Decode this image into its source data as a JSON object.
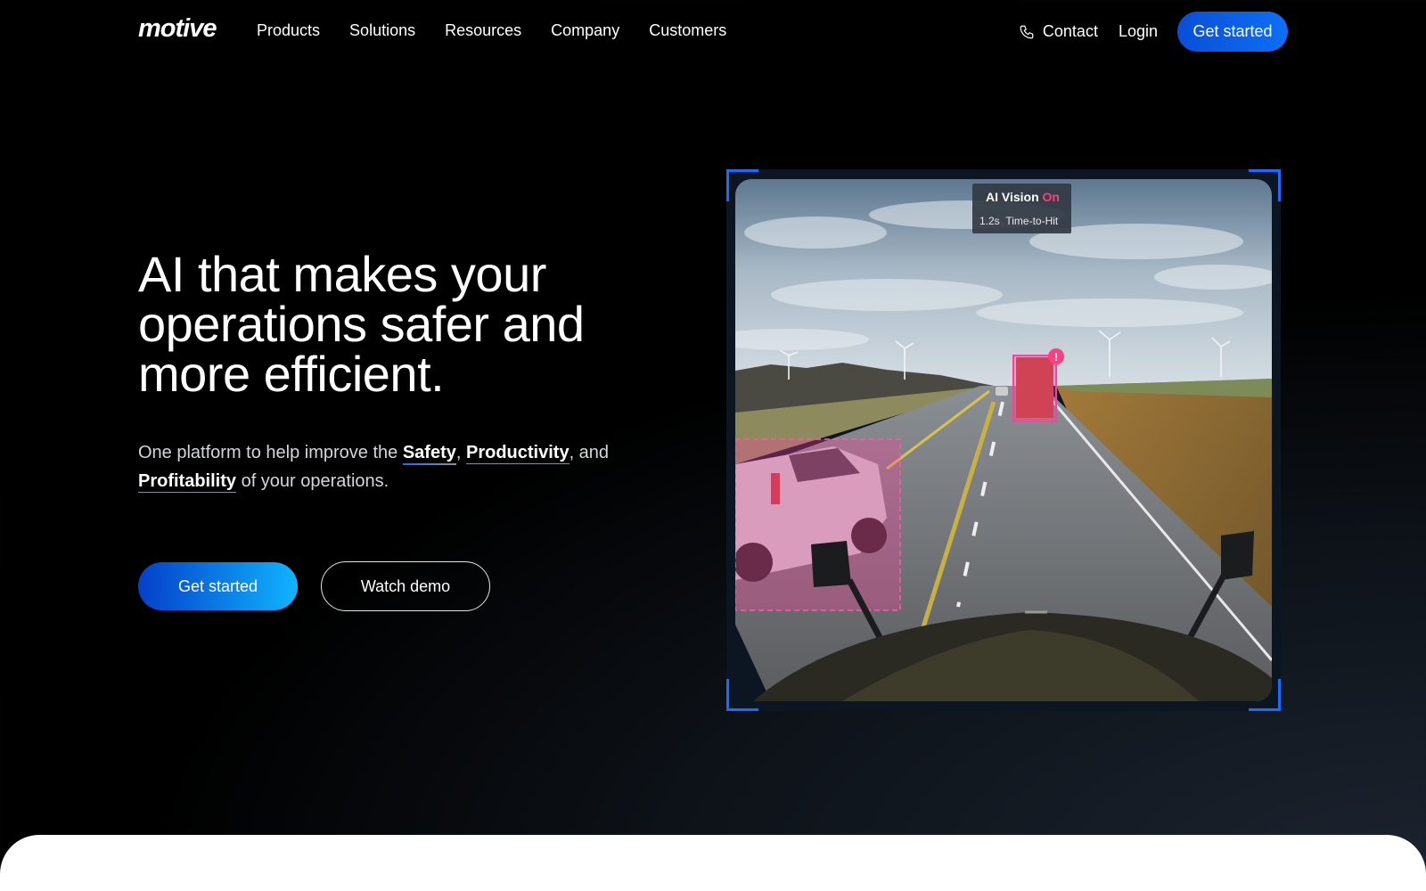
{
  "brand": {
    "logo_text": "motive"
  },
  "nav": {
    "items": [
      {
        "label": "Products"
      },
      {
        "label": "Solutions"
      },
      {
        "label": "Resources"
      },
      {
        "label": "Company"
      },
      {
        "label": "Customers"
      }
    ],
    "contact_label": "Contact",
    "login_label": "Login",
    "cta_label": "Get started"
  },
  "hero": {
    "headline_line1": "AI that makes your",
    "headline_line2": "operations safer and",
    "headline_line3": "more efficient.",
    "sub_prefix": "One platform to help improve the ",
    "sub_safety": "Safety",
    "sub_sep1": ", ",
    "sub_productivity": "Productivity",
    "sub_sep2": ", and ",
    "sub_profitability": "Profitability",
    "sub_suffix": " of your operations.",
    "primary_cta": "Get started",
    "secondary_cta": "Watch demo"
  },
  "video": {
    "badge_title": "AI Vision",
    "badge_state": "On",
    "badge_metric_value": "1.2s",
    "badge_metric_label": "Time-to-Hit",
    "alert_glyph": "!"
  },
  "colors": {
    "accent_blue": "#0d6ff5",
    "alert_pink": "#ff3f7f",
    "frame_corner": "#1b6bff"
  }
}
